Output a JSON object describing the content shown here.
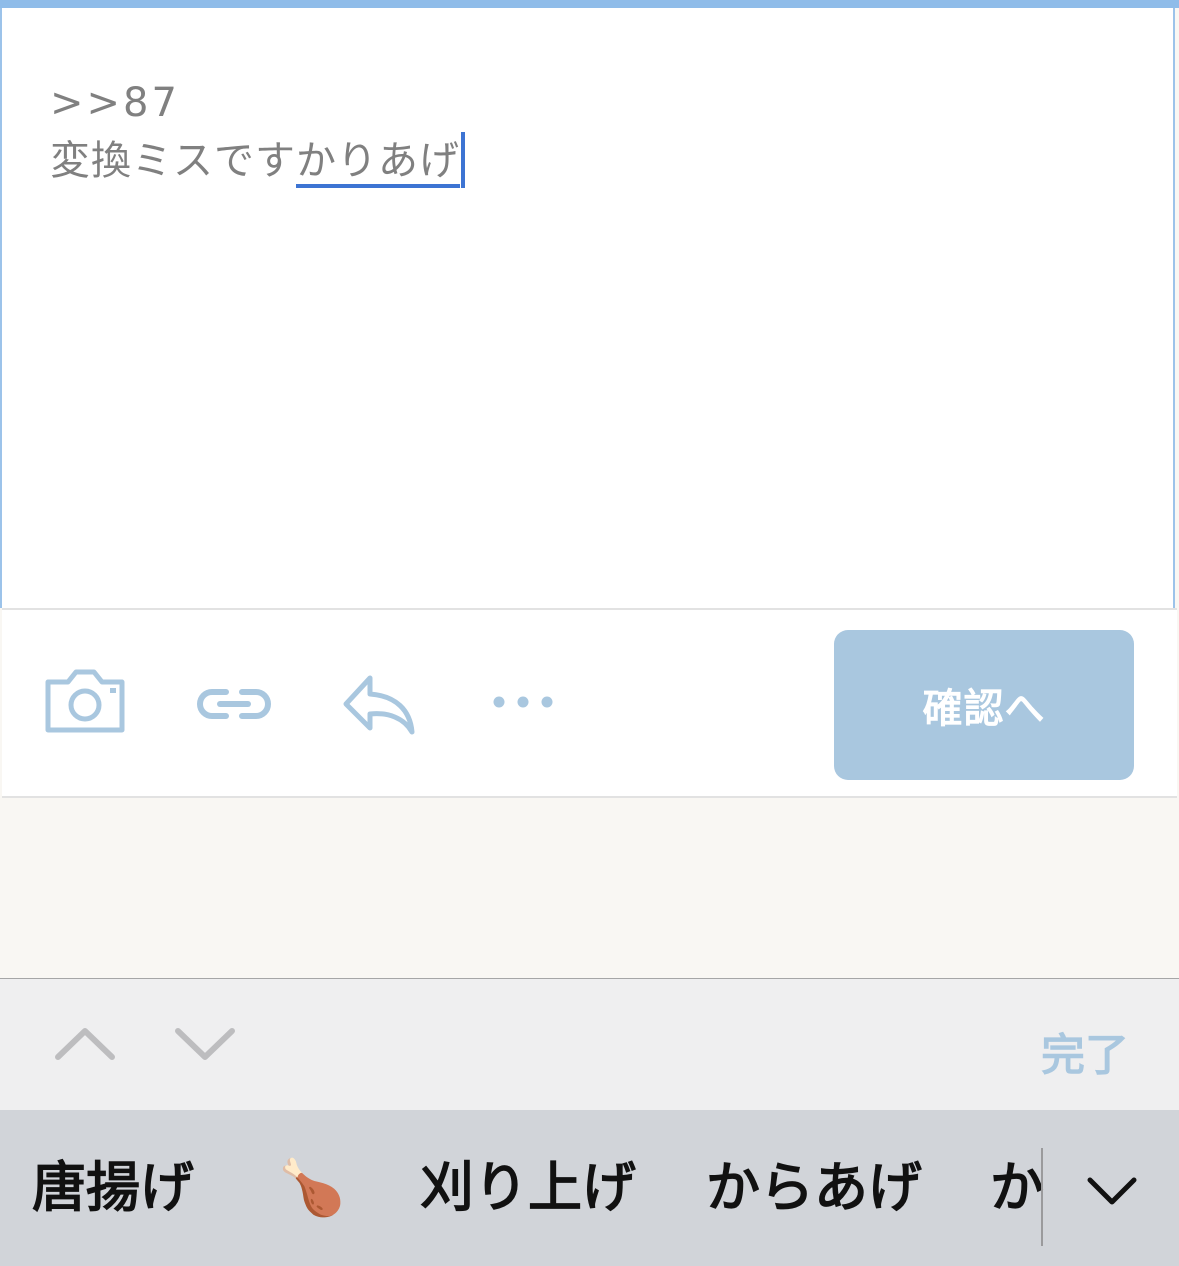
{
  "editor": {
    "line1": ">>87",
    "line2_plain": "変換ミスです",
    "line2_marked": "かりあげ"
  },
  "toolbar": {
    "icons": [
      "camera-icon",
      "link-icon",
      "reply-icon",
      "more-icon"
    ],
    "confirm_label": "確認へ"
  },
  "accessory": {
    "done_label": "完了"
  },
  "candidates": {
    "items": [
      "唐揚げ",
      "🍗",
      "刈り上げ",
      "からあげ",
      "か"
    ]
  },
  "colors": {
    "accent": "#3d74d3",
    "icon": "#a9c7df",
    "button": "#a9c7df",
    "background": "#f9f7f3"
  }
}
